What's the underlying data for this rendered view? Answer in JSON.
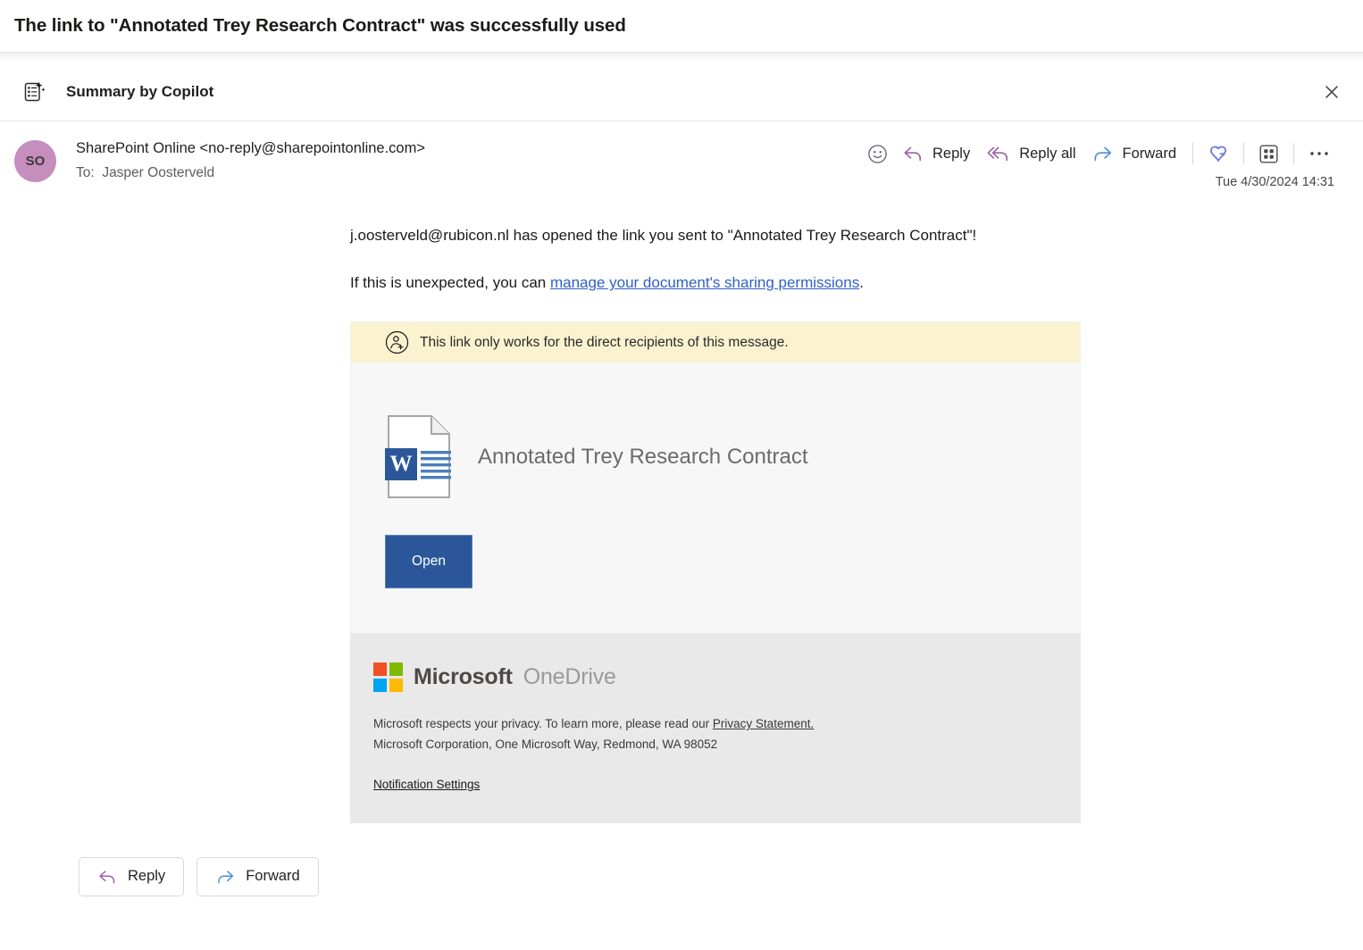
{
  "subject": {
    "text": "The link to \"Annotated Trey Research Contract\" was successfully used"
  },
  "copilot": {
    "icon": "copilot-summary-icon",
    "label": "Summary by Copilot",
    "close_icon": "close-icon"
  },
  "header": {
    "avatar_initials": "SO",
    "sender": "SharePoint Online <no-reply@sharepointonline.com>",
    "to_label": "To:",
    "to_recipient": "Jasper Oosterveld",
    "timestamp": "Tue 4/30/2024 14:31",
    "actions": [
      {
        "name": "react-emoji-button",
        "icon": "smiley-icon",
        "label": ""
      },
      {
        "name": "reply-button",
        "icon": "reply-arrow-icon",
        "label": "Reply"
      },
      {
        "name": "reply-all-button",
        "icon": "reply-all-arrow-icon",
        "label": "Reply all"
      },
      {
        "name": "forward-button",
        "icon": "forward-arrow-icon",
        "label": "Forward"
      },
      {
        "name": "loop-button",
        "icon": "loop-icon",
        "label": ""
      },
      {
        "name": "apps-button",
        "icon": "apps-grid-icon",
        "label": ""
      },
      {
        "name": "more-actions-button",
        "icon": "ellipsis-icon",
        "label": ""
      }
    ]
  },
  "body": {
    "paragraph1": "j.oosterveld@rubicon.nl has opened the link you sent to \"Annotated Trey Research Contract\"!",
    "paragraph2_prefix": "If this is unexpected, you can ",
    "paragraph2_link": "manage your document's sharing permissions",
    "paragraph2_suffix": "."
  },
  "card": {
    "notice_icon": "person-add-circle-icon",
    "notice_text": "This link only works for the direct recipients of this message.",
    "doc_icon": "word-document-icon",
    "doc_title": "Annotated Trey Research Contract",
    "open_button": "Open"
  },
  "footer": {
    "logo_icon": "microsoft-logo-icon",
    "brand_microsoft": "Microsoft",
    "brand_product": "OneDrive",
    "privacy_prefix": "Microsoft respects your privacy. To learn more, please read our ",
    "privacy_link": "Privacy Statement.",
    "address": "Microsoft Corporation, One Microsoft Way, Redmond, WA 98052",
    "notification_settings": "Notification Settings"
  },
  "bottom": {
    "reply_label": "Reply",
    "forward_label": "Forward"
  },
  "colors": {
    "reply_arrow": "#9b5fa8",
    "forward_arrow": "#4a8fd6",
    "link": "#2f5fc4",
    "word_blue": "#2b579a",
    "open_button": "#2b579a",
    "notice_bg": "#fbf2d0",
    "card_bg": "#f7f7f7",
    "footer_bg": "#e9e9e9",
    "avatar_bg": "#c58ebd",
    "ms_red": "#f25022",
    "ms_green": "#7fba00",
    "ms_blue": "#00a4ef",
    "ms_yellow": "#ffb900",
    "loop_icon": "#6477d6"
  }
}
